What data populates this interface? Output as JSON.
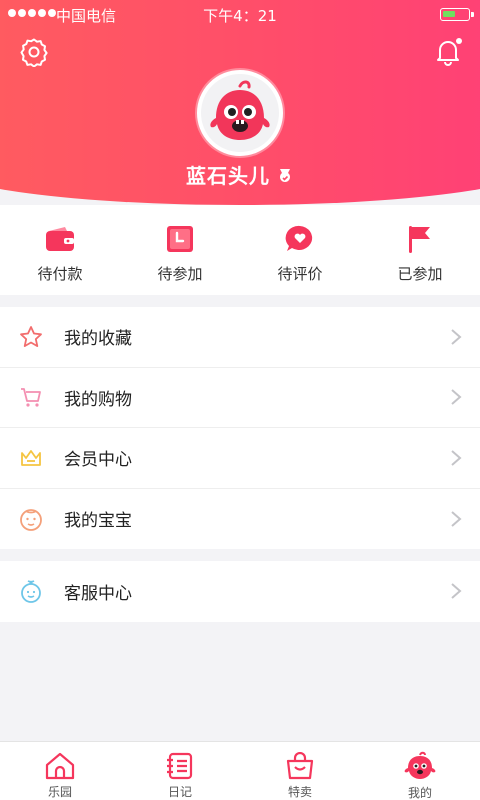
{
  "status_bar": {
    "carrier": "中国电信",
    "time": "下午4：21",
    "battery_level": 0.5
  },
  "profile": {
    "username": "蓝石头儿"
  },
  "orders": [
    {
      "label": "待付款",
      "icon": "wallet-icon"
    },
    {
      "label": "待参加",
      "icon": "calendar-clock-icon"
    },
    {
      "label": "待评价",
      "icon": "comment-heart-icon"
    },
    {
      "label": "已参加",
      "icon": "flag-icon"
    }
  ],
  "menu_group1": [
    {
      "label": "我的收藏",
      "icon": "star-icon",
      "color": "#f26d6d"
    },
    {
      "label": "我的购物",
      "icon": "cart-icon",
      "color": "#f48fb1"
    },
    {
      "label": "会员中心",
      "icon": "crown-icon",
      "color": "#f5c542"
    },
    {
      "label": "我的宝宝",
      "icon": "baby-face-icon",
      "color": "#f4a07a"
    }
  ],
  "menu_group2": [
    {
      "label": "客服中心",
      "icon": "service-icon",
      "color": "#6ec6e8"
    }
  ],
  "tabs": [
    {
      "label": "乐园",
      "icon": "home-icon"
    },
    {
      "label": "日记",
      "icon": "diary-icon"
    },
    {
      "label": "特卖",
      "icon": "shopping-bag-icon"
    },
    {
      "label": "我的",
      "icon": "mascot-icon"
    }
  ],
  "colors": {
    "accent": "#ff4d6a",
    "gradient_start": "#ff5e5e",
    "gradient_end": "#ff3e78"
  }
}
